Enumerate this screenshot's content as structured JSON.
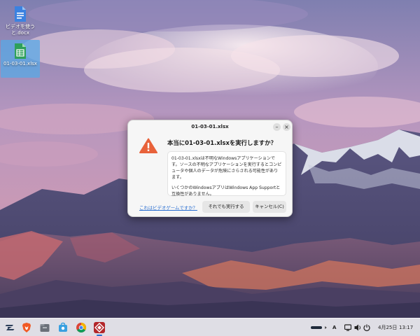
{
  "desktop": {
    "icons": [
      {
        "label": "ビデオを使うと.docx",
        "type": "word-document-icon",
        "selected": false
      },
      {
        "label": "01-03-01.xlsx",
        "type": "spreadsheet-icon",
        "selected": true
      }
    ]
  },
  "dialog": {
    "title": "01-03-01.xlsx",
    "minimize_label": "–",
    "close_label": "×",
    "heading": "本当に01-03-01.xlsxを実行しますか？",
    "body_paragraph_1": "01-03-01.xlsxは不明なWindowsアプリケーションです。ソースの不明なアプリケーションを実行するとコンピュータや個人のデータが危険にさらされる可能性があります。",
    "body_paragraph_2": "いくつかのWindowsアプリはWindows App Supportと互換性がありません。",
    "link_label": "これはビデオゲームですか？",
    "run_label": "それでも実行する",
    "cancel_label": "キャンセル(C)"
  },
  "taskbar": {
    "launcher_icon": "zorin-menu-icon",
    "apps": [
      "brave-browser-icon",
      "files-icon",
      "software-store-icon",
      "chrome-icon",
      "app-icon"
    ],
    "keyboard_layout": "A",
    "date": "4月25日",
    "time": "13:17"
  },
  "colors": {
    "accent": "#2a6fd1",
    "warning": "#e8623a",
    "selection": "#58a8e6"
  }
}
